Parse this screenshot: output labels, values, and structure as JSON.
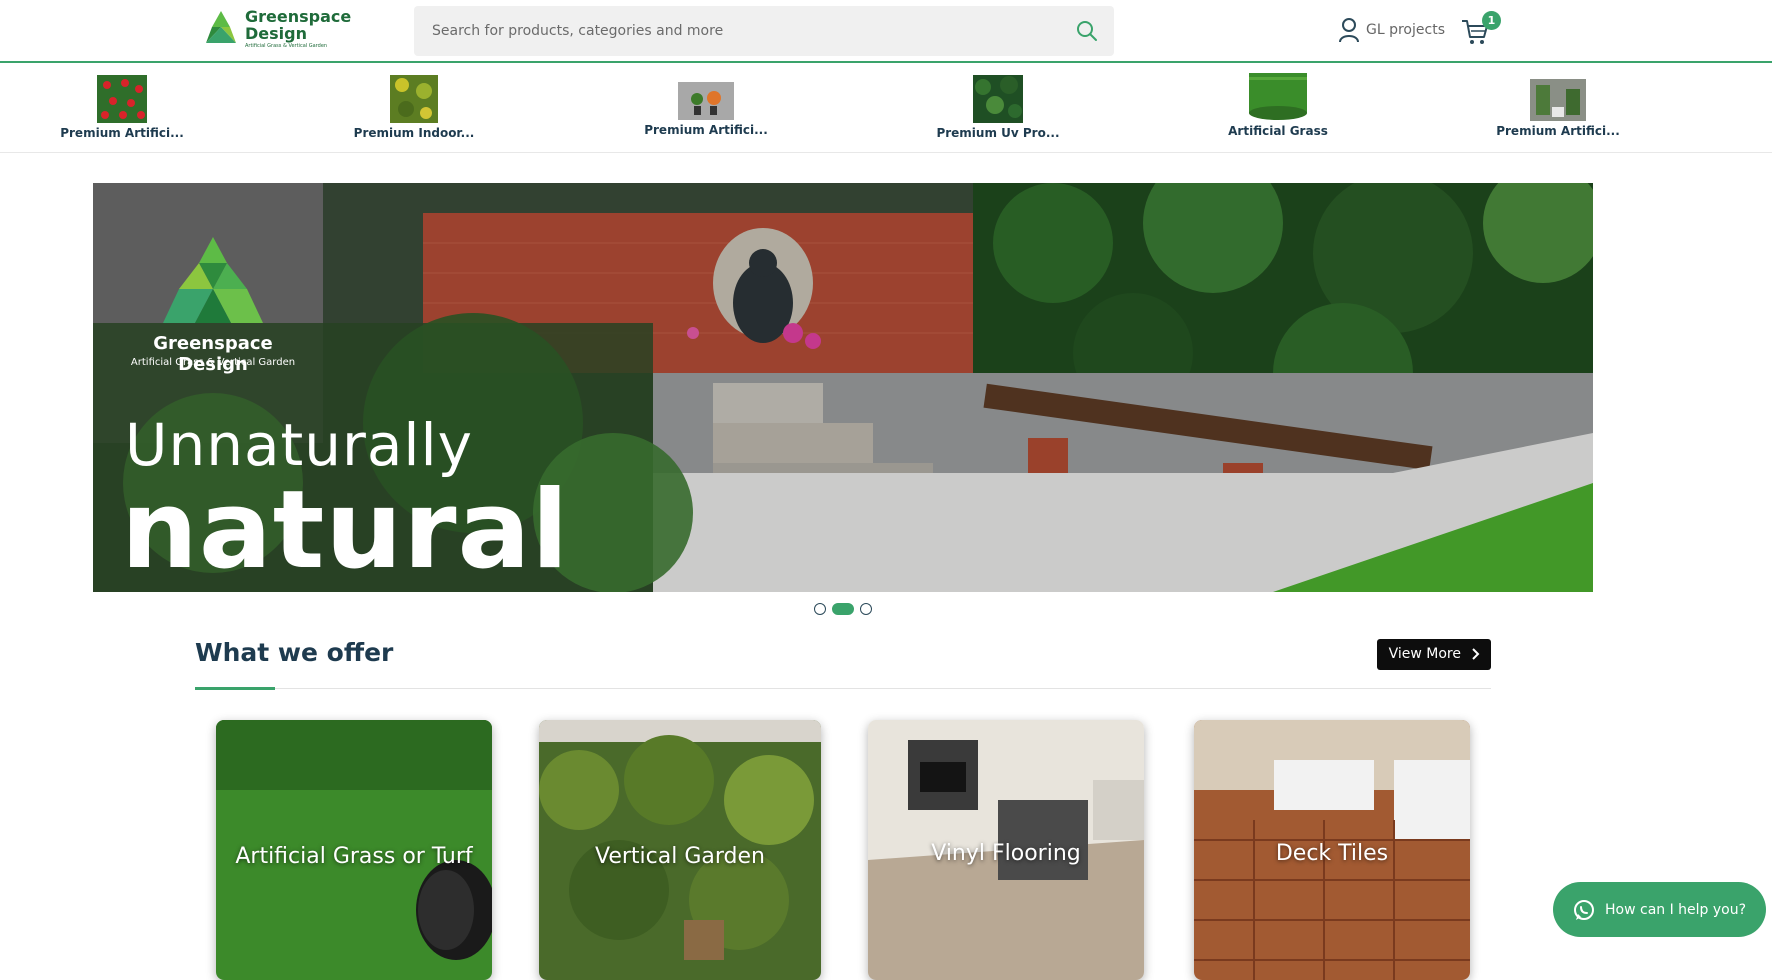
{
  "header": {
    "logo_line1": "Greenspace",
    "logo_line2": "Design",
    "logo_tagline": "Artificial Grass & Vertical Garden",
    "search_placeholder": "Search for products, categories and more",
    "account_label": "GL projects",
    "cart_count": "1"
  },
  "categories": [
    {
      "label": "Premium Artifici..."
    },
    {
      "label": "Premium Indoor..."
    },
    {
      "label": "Premium Artifici..."
    },
    {
      "label": "Premium Uv Pro..."
    },
    {
      "label": "Artificial Grass"
    },
    {
      "label": "Premium Artifici..."
    }
  ],
  "hero": {
    "brand_name": "Greenspace Design",
    "brand_tagline": "Artificial Grass & Vertical Garden",
    "line1": "Unnaturally",
    "line2": "natural",
    "slide_count": 3,
    "active_slide": 2
  },
  "offer": {
    "title": "What we offer",
    "view_more": "View More",
    "cards": [
      {
        "title": "Artificial Grass or Turf"
      },
      {
        "title": "Vertical Garden"
      },
      {
        "title": "Vinyl Flooring"
      },
      {
        "title": "Deck Tiles"
      }
    ]
  },
  "whatsapp": {
    "label": "How can I help you?"
  },
  "colors": {
    "accent": "#3aa36b",
    "heading": "#1e3b4f"
  }
}
